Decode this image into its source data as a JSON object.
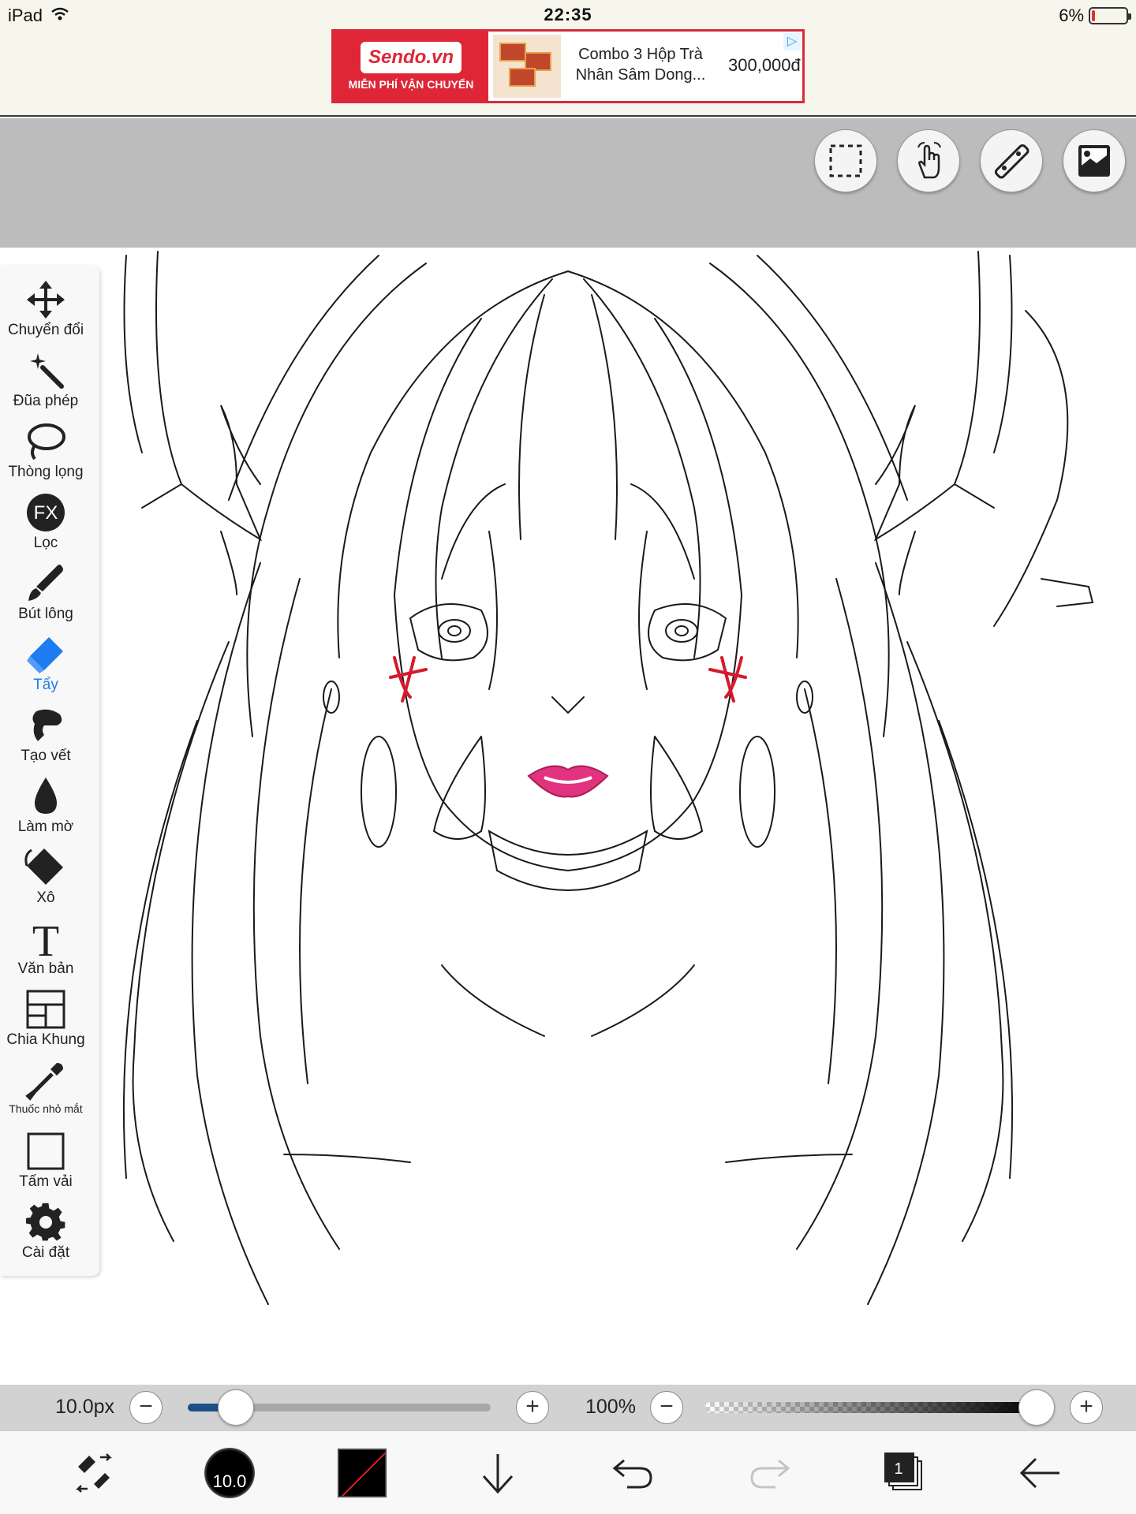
{
  "status_bar": {
    "device": "iPad",
    "time": "22:35",
    "battery": "6%"
  },
  "ad": {
    "brand": "Sendo.vn",
    "brand_tag": "MIỄN PHÍ VẬN CHUYỂN",
    "title": "Combo 3 Hộp Trà Nhân Sâm Dong...",
    "price": "300,000đ"
  },
  "top_tools": [
    {
      "name": "selection-icon"
    },
    {
      "name": "hand-gesture-icon"
    },
    {
      "name": "ruler-icon"
    },
    {
      "name": "image-icon"
    }
  ],
  "tools": [
    {
      "label": "Chuyển đổi",
      "icon": "move-icon"
    },
    {
      "label": "Đũa phép",
      "icon": "magic-wand-icon"
    },
    {
      "label": "Thòng lọng",
      "icon": "lasso-icon"
    },
    {
      "label": "Lọc",
      "icon": "fx-icon"
    },
    {
      "label": "Bút lông",
      "icon": "brush-icon"
    },
    {
      "label": "Tẩy",
      "icon": "eraser-icon",
      "active": true
    },
    {
      "label": "Tạo vết",
      "icon": "smudge-icon"
    },
    {
      "label": "Làm mờ",
      "icon": "blur-drop-icon"
    },
    {
      "label": "Xô",
      "icon": "bucket-icon"
    },
    {
      "label": "Văn bản",
      "icon": "text-icon"
    },
    {
      "label": "Chia Khung",
      "icon": "frame-divider-icon"
    },
    {
      "label": "Thuốc nhỏ mắt",
      "icon": "eyedropper-icon"
    },
    {
      "label": "Tấm vải",
      "icon": "canvas-icon"
    },
    {
      "label": "Cài đặt",
      "icon": "gear-icon"
    }
  ],
  "sliders": {
    "size_label": "10.0px",
    "size_fraction": 0.16,
    "opacity_label": "100%",
    "opacity_fraction": 1.0,
    "minus": "−",
    "plus": "+"
  },
  "bottom_bar": {
    "brush_size": "10.0",
    "layer_count": "1",
    "colors": {
      "primary": "#000000",
      "slider_fill": "#1f4f87",
      "active_tool": "#1d7cf2"
    }
  }
}
